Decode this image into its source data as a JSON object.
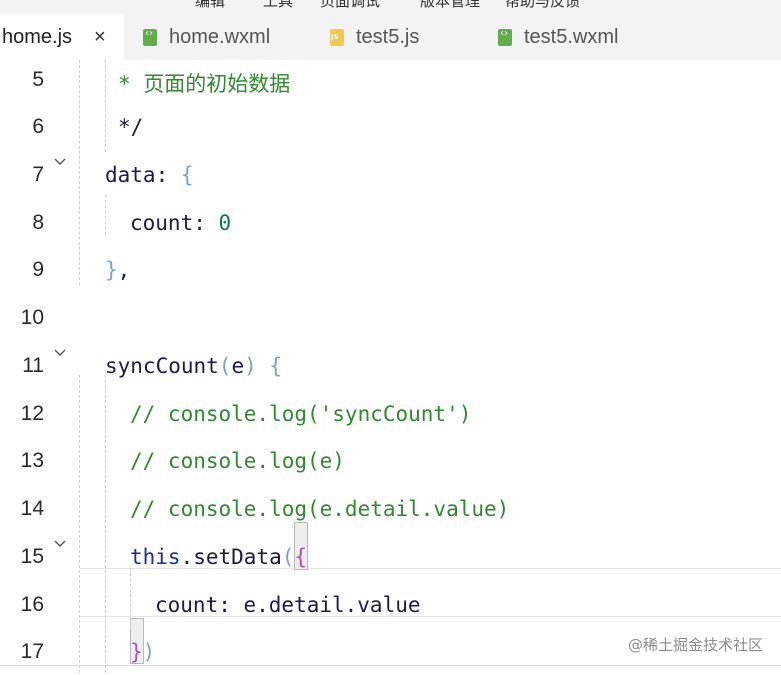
{
  "menubar": {
    "items": [
      "编辑",
      "工具",
      "页面调试",
      "版本管理",
      "帮助与反馈"
    ]
  },
  "tabs": [
    {
      "label": "home.js",
      "active": true,
      "icon": "none",
      "close": "×"
    },
    {
      "label": "home.wxml",
      "active": false,
      "icon": "wxml-file-icon"
    },
    {
      "label": "test5.js",
      "active": false,
      "icon": "js-file-icon"
    },
    {
      "label": "test5.wxml",
      "active": false,
      "icon": "wxml-file-icon"
    }
  ],
  "lines": [
    {
      "num": "5",
      "fold": false,
      "tokens": [
        {
          "t": "* 页面的初始数据",
          "c": "comment"
        }
      ]
    },
    {
      "num": "6",
      "fold": false,
      "tokens": [
        {
          "t": "*/",
          "c": "key"
        }
      ]
    },
    {
      "num": "7",
      "fold": true,
      "tokens": [
        {
          "t": "data",
          "c": "key"
        },
        {
          "t": ": ",
          "c": "key"
        },
        {
          "t": "{",
          "c": "punc"
        }
      ]
    },
    {
      "num": "8",
      "fold": false,
      "tokens": [
        {
          "t": "count",
          "c": "key"
        },
        {
          "t": ": ",
          "c": "key"
        },
        {
          "t": "0",
          "c": "num"
        }
      ]
    },
    {
      "num": "9",
      "fold": false,
      "tokens": [
        {
          "t": "}",
          "c": "punc"
        },
        {
          "t": ",",
          "c": "key"
        }
      ]
    },
    {
      "num": "10",
      "fold": false,
      "tokens": []
    },
    {
      "num": "11",
      "fold": true,
      "tokens": [
        {
          "t": "syncCount",
          "c": "key"
        },
        {
          "t": "(",
          "c": "punc"
        },
        {
          "t": "e",
          "c": "key"
        },
        {
          "t": ")",
          "c": "punc"
        },
        {
          "t": " ",
          "c": "key"
        },
        {
          "t": "{",
          "c": "punc"
        }
      ]
    },
    {
      "num": "12",
      "fold": false,
      "tokens": [
        {
          "t": "// console.log('syncCount')",
          "c": "comment"
        }
      ]
    },
    {
      "num": "13",
      "fold": false,
      "tokens": [
        {
          "t": "// console.log(e)",
          "c": "comment"
        }
      ]
    },
    {
      "num": "14",
      "fold": false,
      "tokens": [
        {
          "t": "// console.log(e.detail.value)",
          "c": "comment"
        }
      ]
    },
    {
      "num": "15",
      "fold": true,
      "tokens": [
        {
          "t": "this",
          "c": "this"
        },
        {
          "t": ".setData",
          "c": "key"
        },
        {
          "t": "(",
          "c": "punc"
        },
        {
          "t": "{",
          "c": "paren"
        }
      ]
    },
    {
      "num": "16",
      "fold": false,
      "tokens": [
        {
          "t": "count",
          "c": "key"
        },
        {
          "t": ": e.detail.value",
          "c": "key"
        }
      ]
    },
    {
      "num": "17",
      "fold": false,
      "tokens": [
        {
          "t": "}",
          "c": "paren"
        },
        {
          "t": ")",
          "c": "punc"
        }
      ]
    }
  ],
  "watermark": "@稀土掘金技术社区",
  "colors": {
    "comment": "#2e8a2e",
    "keyword": "#1a1a4d",
    "punctuation": "#7fa2bd",
    "number": "#0c7a5a",
    "this": "#1b2b9a",
    "bracket_match": "#b04fb0"
  }
}
